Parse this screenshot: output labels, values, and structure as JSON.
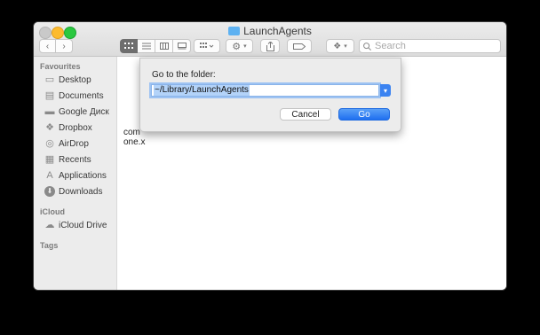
{
  "window": {
    "title": "LaunchAgents"
  },
  "toolbar": {
    "back_icon": "‹",
    "forward_icon": "›",
    "view_icons": [
      "grid",
      "list",
      "columns",
      "gallery"
    ],
    "group_icon": "group",
    "action_icon": "gear",
    "share_icon": "share",
    "tag_icon": "tag",
    "dropbox_icon": "dropbox",
    "search_placeholder": "Search"
  },
  "sidebar": {
    "favourites_title": "Favourites",
    "favourites": [
      {
        "label": "Desktop",
        "icon": "desktop-icon"
      },
      {
        "label": "Documents",
        "icon": "documents-icon"
      },
      {
        "label": "Google Диск",
        "icon": "folder-icon"
      },
      {
        "label": "Dropbox",
        "icon": "dropbox-icon"
      },
      {
        "label": "AirDrop",
        "icon": "airdrop-icon"
      },
      {
        "label": "Recents",
        "icon": "recents-icon"
      },
      {
        "label": "Applications",
        "icon": "applications-icon"
      },
      {
        "label": "Downloads",
        "icon": "downloads-icon"
      }
    ],
    "icloud_title": "iCloud",
    "icloud": [
      {
        "label": "iCloud Drive",
        "icon": "cloud-icon"
      }
    ],
    "tags_title": "Tags"
  },
  "content": {
    "partial_file_line1": "com",
    "partial_file_line2": "one.x"
  },
  "dialog": {
    "label": "Go to the folder:",
    "path_value": "~/Library/LaunchAgents",
    "cancel_label": "Cancel",
    "go_label": "Go",
    "accent_color": "#1f6ff0"
  }
}
